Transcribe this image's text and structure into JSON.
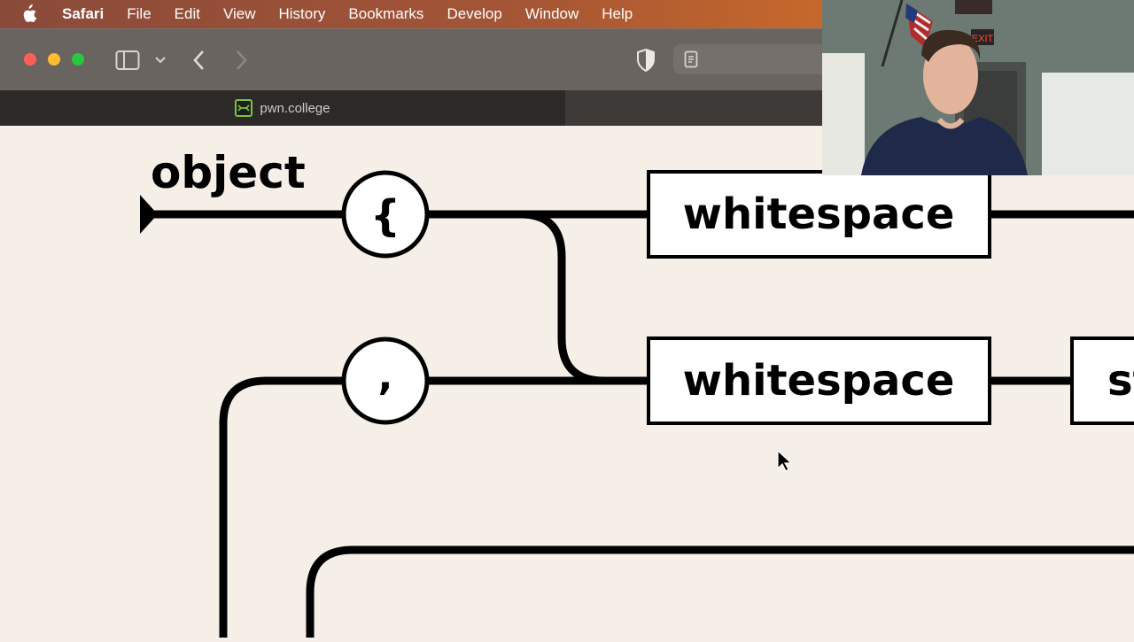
{
  "menubar": {
    "app": "Safari",
    "items": [
      "File",
      "Edit",
      "View",
      "History",
      "Bookmarks",
      "Develop",
      "Window",
      "Help"
    ]
  },
  "toolbar": {
    "icons": [
      "sidebar-icon",
      "chevron-down-icon",
      "back-arrow-icon",
      "forward-arrow-icon",
      "shield-icon",
      "page-icon"
    ]
  },
  "tab": {
    "title": "pwn.college"
  },
  "diagram": {
    "title": "object",
    "open_brace": "{",
    "comma": ",",
    "whitespace_1": "whitespace",
    "whitespace_2": "whitespace",
    "partial_box": "st"
  },
  "webcam": {
    "exit_sign": "EXIT"
  },
  "colors": {
    "menubar_start": "#8a4a3a",
    "menubar_end": "#d77424",
    "page_background": "#f6efe7",
    "diagram_stroke": "#000000",
    "favicon_accent": "#7fc241"
  }
}
